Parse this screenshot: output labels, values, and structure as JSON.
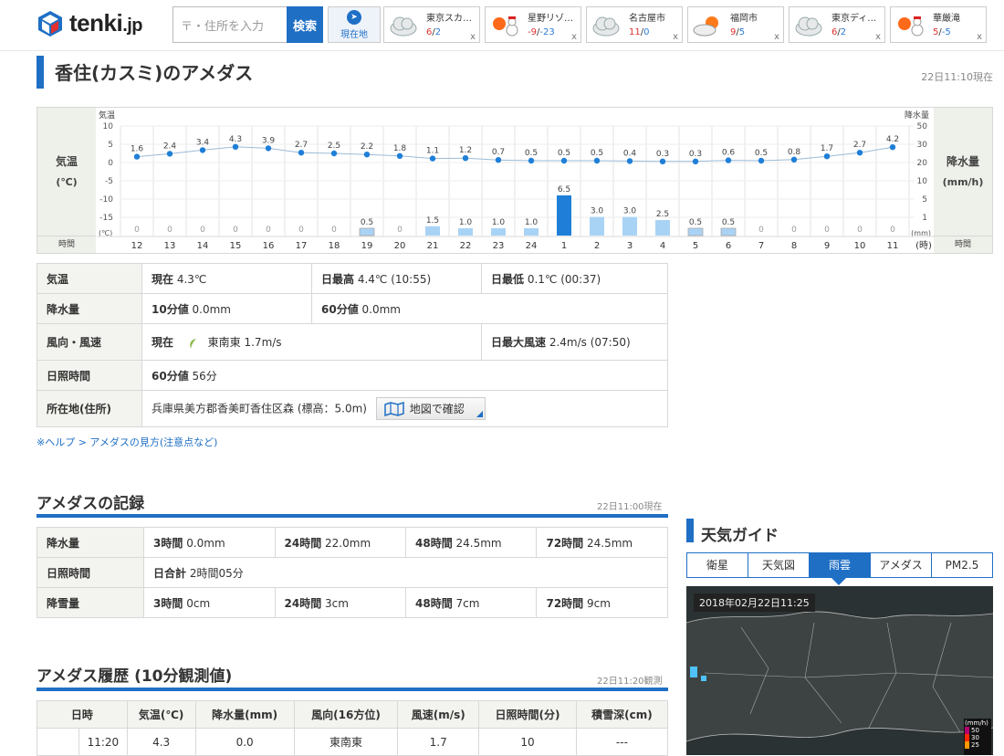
{
  "header": {
    "logo_text": "tenki",
    "logo_suffix": ".jp",
    "search_placeholder": "〒・住所を入力",
    "search_button": "検索",
    "location_button": "現在地",
    "cards": [
      {
        "name": "東京スカ…",
        "high": "6",
        "low": "2",
        "icon": "cloudy-icon"
      },
      {
        "name": "星野リゾ…",
        "high": "-9",
        "low": "-23",
        "icon": "sun-snow-icon"
      },
      {
        "name": "名古屋市",
        "high": "11",
        "low": "0",
        "icon": "cloudy-icon"
      },
      {
        "name": "福岡市",
        "high": "9",
        "low": "5",
        "icon": "cloud-sun-icon"
      },
      {
        "name": "東京ディ…",
        "high": "6",
        "low": "2",
        "icon": "cloudy-icon"
      },
      {
        "name": "華厳滝",
        "high": "5",
        "low": "-5",
        "icon": "sun-snow-icon"
      }
    ],
    "close_label": "x"
  },
  "title": "香住(カスミ)のアメダス",
  "updated": "22日11:10現在",
  "chart_data": {
    "type": "bar",
    "categories": [
      "12",
      "13",
      "14",
      "15",
      "16",
      "17",
      "18",
      "19",
      "20",
      "21",
      "22",
      "23",
      "24",
      "1",
      "2",
      "3",
      "4",
      "5",
      "6",
      "7",
      "8",
      "9",
      "10",
      "11"
    ],
    "series": [
      {
        "name": "気温",
        "values": [
          1.6,
          2.4,
          3.4,
          4.3,
          3.9,
          2.7,
          2.5,
          2.2,
          1.8,
          1.1,
          1.2,
          0.7,
          0.5,
          0.5,
          0.5,
          0.4,
          0.3,
          0.3,
          0.6,
          0.5,
          0.8,
          1.7,
          2.7,
          4.2
        ]
      },
      {
        "name": "降水量",
        "values": [
          0,
          0,
          0,
          0,
          0,
          0,
          0,
          0.5,
          0,
          1.5,
          1.0,
          1.0,
          1.0,
          6.5,
          3.0,
          3.0,
          2.5,
          0.5,
          0.5,
          0,
          0,
          0,
          0,
          0
        ]
      }
    ],
    "left_label": "気温",
    "left_unit": "(℃)",
    "left_axis_title": "気温",
    "left_ticks": [
      "10",
      "5",
      "0",
      "-5",
      "-10",
      "-15"
    ],
    "left_unit_small": "(℃)",
    "right_label": "降水量",
    "right_unit": "(mm/h)",
    "right_axis_title": "降水量",
    "right_ticks": [
      "50",
      "30",
      "20",
      "10",
      "5",
      "1"
    ],
    "right_unit_small": "(mm)",
    "time_label": "時間",
    "time_suffix": "(時)",
    "ylim_temp": [
      -20,
      10
    ]
  },
  "info": {
    "temp_label": "気温",
    "temp_now_k": "現在",
    "temp_now": "4.3℃",
    "temp_max_k": "日最高",
    "temp_max": "4.4℃ (10:55)",
    "temp_min_k": "日最低",
    "temp_min": "0.1℃ (00:37)",
    "rain_label": "降水量",
    "rain10_k": "10分値",
    "rain10": "0.0mm",
    "rain60_k": "60分値",
    "rain60": "0.0mm",
    "wind_label": "風向・風速",
    "wind_now_k": "現在",
    "wind_now": "東南東 1.7m/s",
    "wind_max_k": "日最大風速",
    "wind_max": "2.4m/s (07:50)",
    "sun_label": "日照時間",
    "sun_k": "60分値",
    "sun": "56分",
    "addr_label": "所在地(住所)",
    "addr": "兵庫県美方郡香美町香住区森 (標高：5.0m)",
    "map_button": "地図で確認"
  },
  "help_link": "※ヘルプ > アメダスの見方(注意点など)",
  "record": {
    "title": "アメダスの記録",
    "time": "22日11:00現在",
    "rows": [
      {
        "label": "降水量",
        "cells": [
          [
            "3時間",
            "0.0mm"
          ],
          [
            "24時間",
            "22.0mm"
          ],
          [
            "48時間",
            "24.5mm"
          ],
          [
            "72時間",
            "24.5mm"
          ]
        ]
      },
      {
        "label": "日照時間",
        "cells": [
          [
            "日合計",
            "2時間05分"
          ]
        ]
      },
      {
        "label": "降雪量",
        "cells": [
          [
            "3時間",
            "0cm"
          ],
          [
            "24時間",
            "3cm"
          ],
          [
            "48時間",
            "7cm"
          ],
          [
            "72時間",
            "9cm"
          ]
        ]
      }
    ]
  },
  "history": {
    "title": "アメダス履歴 (10分観測値)",
    "time": "22日11:20観測",
    "headers": [
      "日時",
      "気温(℃)",
      "降水量(mm)",
      "風向(16方位)",
      "風速(m/s)",
      "日照時間(分)",
      "積雪深(cm)"
    ],
    "row": [
      "11:20",
      "4.3",
      "0.0",
      "東南東",
      "1.7",
      "10",
      "---"
    ]
  },
  "guide": {
    "title": "天気ガイド",
    "tabs": [
      "衛星",
      "天気図",
      "雨雲",
      "アメダス",
      "PM2.5"
    ],
    "map_time": "2018年02月22日11:25",
    "legend_unit": "(mm/h)",
    "legend": [
      "50",
      "30",
      "25"
    ]
  }
}
